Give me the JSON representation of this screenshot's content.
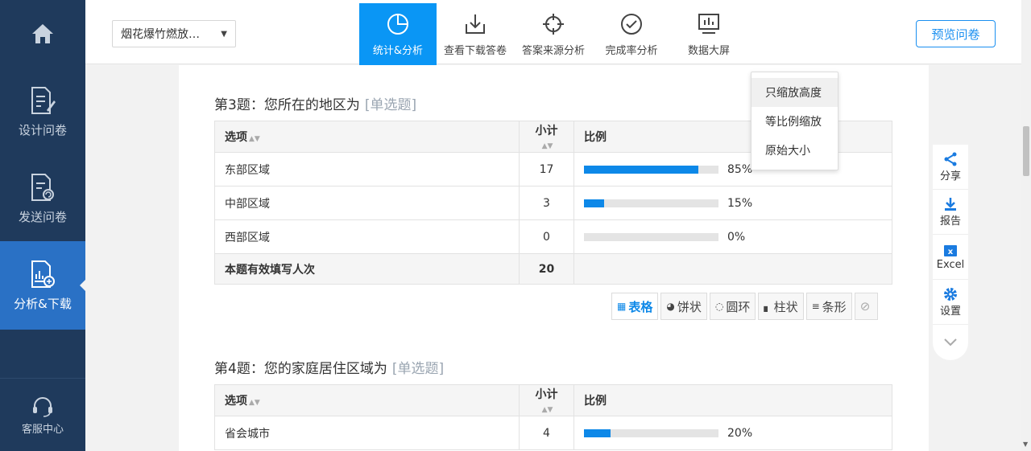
{
  "sidebar": {
    "items": [
      {
        "label": "",
        "icon": "home-icon"
      },
      {
        "label": "设计问卷",
        "icon": "design-icon"
      },
      {
        "label": "发送问卷",
        "icon": "send-icon"
      },
      {
        "label": "分析&下载",
        "icon": "analyze-icon"
      },
      {
        "label": "客服中心",
        "icon": "headset-icon"
      }
    ]
  },
  "header": {
    "survey_name": "烟花爆竹燃放…",
    "nav": [
      {
        "label": "统计&分析",
        "active": true
      },
      {
        "label": "查看下载答卷"
      },
      {
        "label": "答案来源分析"
      },
      {
        "label": "完成率分析"
      },
      {
        "label": "数据大屏"
      }
    ],
    "preview_label": "预览问卷"
  },
  "zoom_menu": {
    "items": [
      "只缩放高度",
      "等比例缩放",
      "原始大小"
    ]
  },
  "tools": {
    "share": "分享",
    "report": "报告",
    "excel": "Excel",
    "settings": "设置"
  },
  "questions": [
    {
      "title": "第3题：您所在的地区为",
      "type": "[单选题]",
      "headers": {
        "option": "选项",
        "count": "小计",
        "ratio": "比例"
      },
      "rows": [
        {
          "option": "东部区域",
          "count": "17",
          "percent": 85,
          "percent_label": "85%"
        },
        {
          "option": "中部区域",
          "count": "3",
          "percent": 15,
          "percent_label": "15%"
        },
        {
          "option": "西部区域",
          "count": "0",
          "percent": 0,
          "percent_label": "0%"
        }
      ],
      "total_label": "本题有效填写人次",
      "total_count": "20"
    },
    {
      "title": "第4题：您的家庭居住区域为",
      "type": "[单选题]",
      "headers": {
        "option": "选项",
        "count": "小计",
        "ratio": "比例"
      },
      "rows": [
        {
          "option": "省会城市",
          "count": "4",
          "percent": 20,
          "percent_label": "20%"
        }
      ]
    }
  ],
  "view_switch": [
    "表格",
    "饼状",
    "圆环",
    "柱状",
    "条形"
  ],
  "colors": {
    "sidebar": "#1f3a5c",
    "accent": "#0a96f5",
    "bar": "#0d88e8"
  }
}
